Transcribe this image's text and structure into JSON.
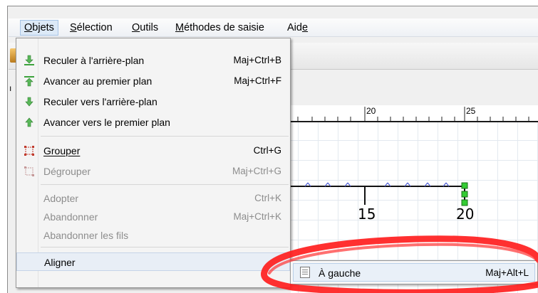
{
  "menubar": {
    "items": [
      {
        "label": "Objets",
        "mnemonic": "O",
        "rest": "bjets"
      },
      {
        "label": "Sélection",
        "mnemonic": "S",
        "rest": "élection"
      },
      {
        "label": "Outils",
        "mnemonic": "O",
        "rest": "utils"
      },
      {
        "label": "Méthodes de saisie",
        "mnemonic": "M",
        "rest": "éthodes de saisie"
      },
      {
        "label": "Aide",
        "pre": "Aid",
        "mnemonic": "e"
      }
    ]
  },
  "left_fragment": "ı",
  "ruler": {
    "label_20": "20",
    "label_25": "25"
  },
  "canvas": {
    "label_15": "15",
    "label_20": "20"
  },
  "dropdown": {
    "items": [
      {
        "label": "Reculer à l'arrière-plan",
        "shortcut": "Maj+Ctrl+B",
        "icon": "arrow-to-bottom-icon"
      },
      {
        "label": "Avancer au premier plan",
        "shortcut": "Maj+Ctrl+F",
        "icon": "arrow-to-top-icon"
      },
      {
        "label": "Reculer vers l'arrière-plan",
        "shortcut": "",
        "icon": "arrow-down-icon"
      },
      {
        "label": "Avancer vers le premier plan",
        "shortcut": "",
        "icon": "arrow-up-icon"
      },
      {
        "label": "Grouper",
        "shortcut": "Ctrl+G",
        "icon": "group-icon"
      },
      {
        "label": "Dégrouper",
        "shortcut": "Maj+Ctrl+G",
        "icon": "ungroup-icon"
      },
      {
        "label": "Adopter",
        "shortcut": "Ctrl+K"
      },
      {
        "label": "Abandonner",
        "shortcut": "Maj+Ctrl+K"
      },
      {
        "label": "Abandonner les fils",
        "shortcut": ""
      },
      {
        "label": "Aligner",
        "shortcut": ""
      }
    ]
  },
  "submenu": {
    "item": {
      "label": "À gauche",
      "shortcut": "Maj+Alt+L",
      "icon": "align-left-icon"
    }
  },
  "colors": {
    "annotation_red": "#ff1a1a",
    "icon_green": "#3da33d",
    "group_red": "#c0392b"
  }
}
